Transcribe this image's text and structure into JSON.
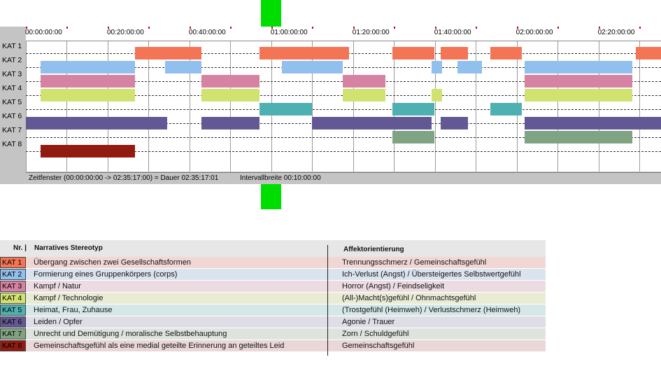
{
  "timeline": {
    "tick_labels": [
      "00:00:00:00",
      "00:20:00:00",
      "00:40:00:00",
      "01:00:00:00",
      "01:20:00:00",
      "01:40:00:00",
      "02:00:00:00",
      "02:20:00:00"
    ],
    "status_window": "Zeitfenster (00:00:00:00 -> 02:35:17:00) = Dauer 02:35:17:01",
    "status_interval": "Intervallbreite 00:10:00:00",
    "window_start_seconds": 0,
    "window_end_seconds": 9317,
    "green_marker_position_seconds": 3600,
    "categories": [
      {
        "label": "KAT 1",
        "color": "#f47555",
        "segments": [
          [
            "00:26:40",
            "00:43:00"
          ],
          [
            "00:57:10",
            "01:19:00"
          ],
          [
            "01:29:40",
            "01:39:50"
          ],
          [
            "01:41:20",
            "01:48:00"
          ],
          [
            "01:53:30",
            "02:01:10"
          ],
          [
            "02:29:10",
            "02:35:17"
          ]
        ]
      },
      {
        "label": "KAT 2",
        "color": "#92c0ee",
        "segments": [
          [
            "00:03:40",
            "00:26:40"
          ],
          [
            "00:34:00",
            "00:43:00"
          ],
          [
            "01:02:40",
            "01:17:30"
          ],
          [
            "01:39:10",
            "01:41:50"
          ],
          [
            "01:45:30",
            "01:51:30"
          ],
          [
            "02:02:00",
            "02:28:20"
          ]
        ]
      },
      {
        "label": "KAT 3",
        "color": "#d682a3",
        "segments": [
          [
            "00:03:40",
            "00:26:40"
          ],
          [
            "00:43:00",
            "00:57:10"
          ],
          [
            "01:17:30",
            "01:27:50"
          ],
          [
            "02:02:00",
            "02:28:20"
          ]
        ]
      },
      {
        "label": "KAT 4",
        "color": "#d1e271",
        "segments": [
          [
            "00:03:40",
            "00:26:40"
          ],
          [
            "00:43:00",
            "00:57:10"
          ],
          [
            "01:17:30",
            "01:27:50"
          ],
          [
            "01:39:10",
            "01:41:50"
          ],
          [
            "02:02:00",
            "02:28:20"
          ]
        ]
      },
      {
        "label": "KAT 5",
        "color": "#4eb0b0",
        "segments": [
          [
            "00:57:10",
            "01:10:00"
          ],
          [
            "01:29:40",
            "01:39:50"
          ],
          [
            "01:53:30",
            "02:01:10"
          ]
        ]
      },
      {
        "label": "KAT 6",
        "color": "#615894",
        "segments": [
          [
            "00:00:00",
            "00:34:30"
          ],
          [
            "00:43:00",
            "00:57:10"
          ],
          [
            "01:10:00",
            "01:39:10"
          ],
          [
            "01:41:20",
            "01:48:00"
          ],
          [
            "02:02:00",
            "02:35:17"
          ]
        ]
      },
      {
        "label": "KAT 7",
        "color": "#80a483",
        "segments": [
          [
            "01:29:40",
            "01:39:50"
          ],
          [
            "02:02:00",
            "02:28:20"
          ]
        ]
      },
      {
        "label": "KAT 8",
        "color": "#911b11",
        "segments": [
          [
            "00:03:40",
            "00:26:40"
          ]
        ]
      }
    ]
  },
  "legend": {
    "col_nr": "Nr. |",
    "col_stereotyp": "Narratives Stereotyp",
    "col_affekt": "Affektorientierung",
    "rows": [
      {
        "kat": "KAT 1",
        "color": "#f47555",
        "bg": "#f0d7d4",
        "stereotyp": "Übergang zwischen zwei Gesellschaftsformen",
        "affekt": "Trennungsschmerz / Gemeinschaftsgefühl"
      },
      {
        "kat": "KAT 2",
        "color": "#92c0ee",
        "bg": "#dbe3ee",
        "stereotyp": "Formierung eines Gruppenkörpers (corps)",
        "affekt": "Ich-Verlust (Angst) / Übersteigertes Selbstwertgefühl"
      },
      {
        "kat": "KAT 3",
        "color": "#d682a3",
        "bg": "#eddbe2",
        "stereotyp": "Kampf / Natur",
        "affekt": "Horror (Angst) / Feindseligkeit"
      },
      {
        "kat": "KAT 4",
        "color": "#d1e271",
        "bg": "#e8ecd5",
        "stereotyp": "Kampf / Technologie",
        "affekt": "(All-)Macht(s)gefühl / Ohnmachtsgefühl"
      },
      {
        "kat": "KAT 5",
        "color": "#4eb0b0",
        "bg": "#d5e8e7",
        "stereotyp": "Heimat, Frau, Zuhause",
        "affekt": "(Trostgefühl (Heimweh) / Verlustschmerz (Heimweh)"
      },
      {
        "kat": "KAT 6",
        "color": "#615894",
        "bg": "#dfdde6",
        "stereotyp": "Leiden / Opfer",
        "affekt": "Agonie / Trauer"
      },
      {
        "kat": "KAT 7",
        "color": "#80a483",
        "bg": "#dfe3de",
        "stereotyp": "Unrecht und Demütigung / moralische Selbstbehauptung",
        "affekt": "Zorn / Schuldgefühl"
      },
      {
        "kat": "KAT 8",
        "color": "#911b11",
        "bg": "#ead7d7",
        "stereotyp": "Gemeinschaftsgefühl als eine medial geteilte Erinnerung an geteiltes Leid",
        "affekt": "Gemeinschaftsgefühl"
      }
    ]
  }
}
